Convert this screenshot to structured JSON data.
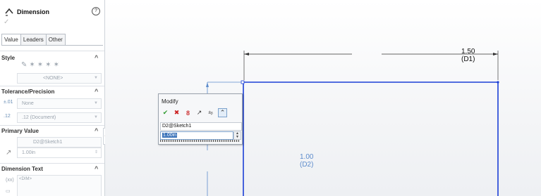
{
  "property_manager": {
    "title": "Dimension",
    "help_label": "?",
    "ok_symbol": "✓",
    "tabs": [
      "Value",
      "Leaders",
      "Other"
    ],
    "style": {
      "header": "Style",
      "favorite": "<NONE>"
    },
    "tolerance": {
      "header": "Tolerance/Precision",
      "tolerance_type": "None",
      "precision": ".12 (Document)"
    },
    "primary_value": {
      "header": "Primary Value",
      "name": "D2@Sketch1",
      "value": "1.00in"
    },
    "dimension_text": {
      "header": "Dimension Text",
      "text": "<DIM>"
    },
    "collapse_symbol": "«"
  },
  "canvas": {
    "dim1": {
      "value": "1.50",
      "name": "(D1)"
    },
    "dim2": {
      "value": "1.00",
      "name": "(D2)"
    },
    "colors": {
      "sketch_line": "#1b3fd6",
      "dimension_line": "#333333",
      "driven_dim": "#5d8ccc"
    }
  },
  "modify_dialog": {
    "title": "Modify",
    "dimension_name": "D2@Sketch1",
    "value": "1.00in"
  }
}
